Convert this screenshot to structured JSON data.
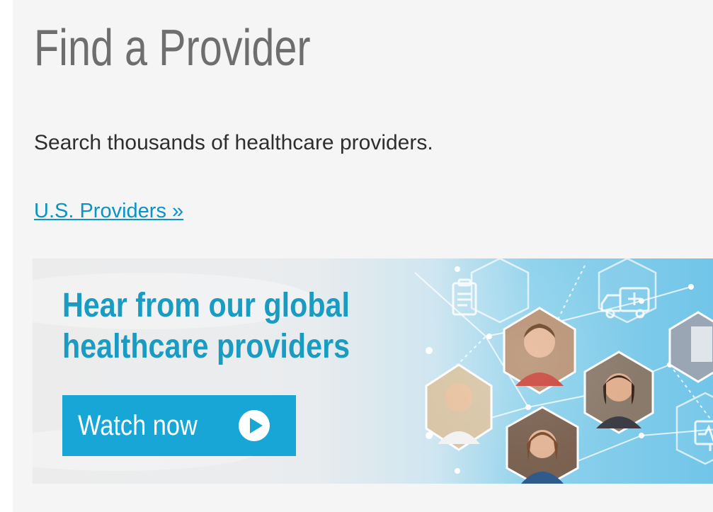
{
  "page": {
    "title": "Find a Provider",
    "subtitle": "Search thousands of healthcare providers.",
    "us_providers_link": "U.S. Providers »"
  },
  "banner": {
    "headline_line1": "Hear from our global",
    "headline_line2": "healthcare providers",
    "cta_label": "Watch now",
    "icons": [
      "clipboard-icon",
      "ambulance-icon",
      "monitor-heartbeat-icon",
      "play-icon"
    ],
    "colors": {
      "accent": "#17a6d6",
      "headline": "#1a9cc2",
      "link": "#0a93c4",
      "title": "#6e6e6e"
    }
  }
}
